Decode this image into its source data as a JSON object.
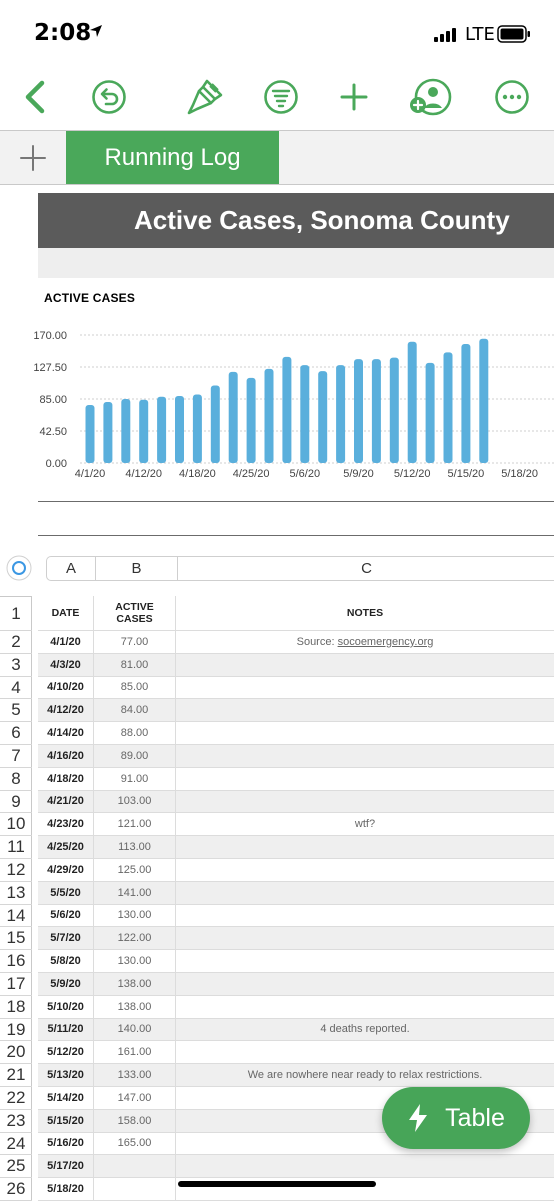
{
  "status": {
    "time": "2:08",
    "carrier": "LTE"
  },
  "toolbar": {
    "icons": [
      "back-chevron-icon",
      "undo-icon",
      "format-brush-icon",
      "sort-filter-icon",
      "add-icon",
      "collaborate-icon",
      "more-icon"
    ]
  },
  "sheets": {
    "add_label": "+",
    "active_tab": "Running Log"
  },
  "title": "Active Cases, Sonoma County",
  "colors": {
    "accent": "#4aa85a",
    "bar": "#5aafdc",
    "title_bg": "#5b5b5b"
  },
  "chart_data": {
    "type": "bar",
    "title": "ACTIVE CASES",
    "categories": [
      "4/1/20",
      "4/3/20",
      "4/10/20",
      "4/12/20",
      "4/14/20",
      "4/16/20",
      "4/18/20",
      "4/21/20",
      "4/23/20",
      "4/25/20",
      "4/29/20",
      "5/5/20",
      "5/6/20",
      "5/7/20",
      "5/8/20",
      "5/9/20",
      "5/10/20",
      "5/11/20",
      "5/12/20",
      "5/13/20",
      "5/14/20",
      "5/15/20",
      "5/16/20",
      "5/17/20",
      "5/18/20"
    ],
    "values": [
      77,
      81,
      85,
      84,
      88,
      89,
      91,
      103,
      121,
      113,
      125,
      141,
      130,
      122,
      130,
      138,
      138,
      140,
      161,
      133,
      147,
      158,
      165,
      null,
      null
    ],
    "xtick_labels": [
      "4/1/20",
      "4/12/20",
      "4/18/20",
      "4/25/20",
      "5/6/20",
      "5/9/20",
      "5/12/20",
      "5/15/20",
      "5/18/20"
    ],
    "ytick_labels": [
      "0.00",
      "42.50",
      "85.00",
      "127.50",
      "170.00"
    ],
    "ylim": [
      0,
      170
    ],
    "xlabel": "",
    "ylabel": "",
    "grid": true
  },
  "table": {
    "column_letters": [
      "A",
      "B",
      "C"
    ],
    "headers": {
      "a": "DATE",
      "b1": "ACTIVE",
      "b2": "CASES",
      "c": "NOTES"
    },
    "row_numbers": [
      "1",
      "2",
      "3",
      "4",
      "5",
      "6",
      "7",
      "8",
      "9",
      "10",
      "11",
      "12",
      "13",
      "14",
      "15",
      "16",
      "17",
      "18",
      "19",
      "20",
      "21",
      "22",
      "23",
      "24",
      "25",
      "26"
    ],
    "rows": [
      {
        "date": "4/1/20",
        "cases": "77.00",
        "note": "Source: ",
        "link": "socoemergency.org"
      },
      {
        "date": "4/3/20",
        "cases": "81.00",
        "note": ""
      },
      {
        "date": "4/10/20",
        "cases": "85.00",
        "note": ""
      },
      {
        "date": "4/12/20",
        "cases": "84.00",
        "note": ""
      },
      {
        "date": "4/14/20",
        "cases": "88.00",
        "note": ""
      },
      {
        "date": "4/16/20",
        "cases": "89.00",
        "note": ""
      },
      {
        "date": "4/18/20",
        "cases": "91.00",
        "note": ""
      },
      {
        "date": "4/21/20",
        "cases": "103.00",
        "note": ""
      },
      {
        "date": "4/23/20",
        "cases": "121.00",
        "note": "wtf?"
      },
      {
        "date": "4/25/20",
        "cases": "113.00",
        "note": ""
      },
      {
        "date": "4/29/20",
        "cases": "125.00",
        "note": ""
      },
      {
        "date": "5/5/20",
        "cases": "141.00",
        "note": ""
      },
      {
        "date": "5/6/20",
        "cases": "130.00",
        "note": ""
      },
      {
        "date": "5/7/20",
        "cases": "122.00",
        "note": ""
      },
      {
        "date": "5/8/20",
        "cases": "130.00",
        "note": ""
      },
      {
        "date": "5/9/20",
        "cases": "138.00",
        "note": ""
      },
      {
        "date": "5/10/20",
        "cases": "138.00",
        "note": ""
      },
      {
        "date": "5/11/20",
        "cases": "140.00",
        "note": "4 deaths reported."
      },
      {
        "date": "5/12/20",
        "cases": "161.00",
        "note": ""
      },
      {
        "date": "5/13/20",
        "cases": "133.00",
        "note": "We are nowhere near ready to relax restrictions."
      },
      {
        "date": "5/14/20",
        "cases": "147.00",
        "note": ""
      },
      {
        "date": "5/15/20",
        "cases": "158.00",
        "note": ""
      },
      {
        "date": "5/16/20",
        "cases": "165.00",
        "note": ""
      },
      {
        "date": "5/17/20",
        "cases": "",
        "note": ""
      },
      {
        "date": "5/18/20",
        "cases": "",
        "note": ""
      }
    ]
  },
  "fab": {
    "label": "Table"
  }
}
